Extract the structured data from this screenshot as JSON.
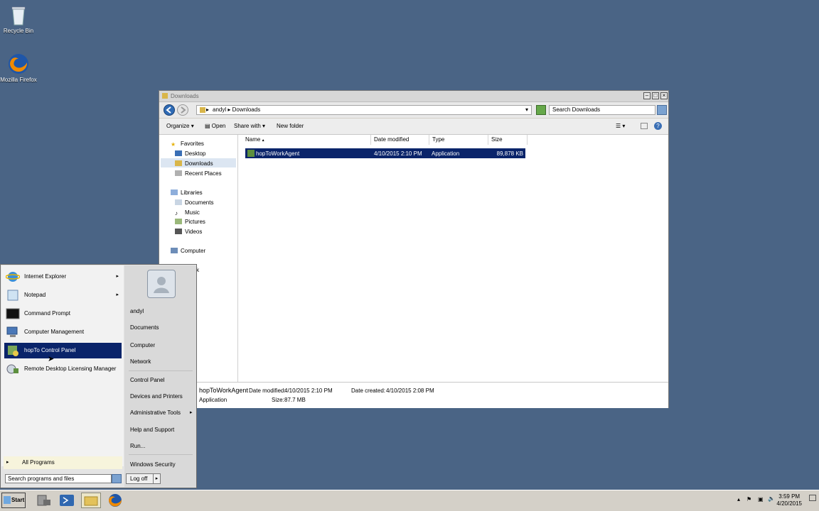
{
  "desktop": {
    "icons": [
      {
        "label": "Recycle Bin",
        "icon": "recycle-bin-icon"
      },
      {
        "label": "Mozilla Firefox",
        "icon": "firefox-icon"
      }
    ]
  },
  "explorer": {
    "title": "Downloads",
    "breadcrumb": [
      "andyl",
      "Downloads"
    ],
    "search_placeholder": "Search Downloads",
    "toolbar": {
      "organize": "Organize",
      "open": "Open",
      "share_with": "Share with",
      "new_folder": "New folder"
    },
    "nav": {
      "favorites": "Favorites",
      "desktop": "Desktop",
      "downloads": "Downloads",
      "recent_places": "Recent Places",
      "libraries": "Libraries",
      "documents": "Documents",
      "music": "Music",
      "pictures": "Pictures",
      "videos": "Videos",
      "computer": "Computer",
      "network_partial": "k"
    },
    "columns": {
      "name": "Name",
      "date_modified": "Date modified",
      "type": "Type",
      "size": "Size"
    },
    "files": [
      {
        "name": "hopToWorkAgent",
        "date_modified": "4/10/2015 2:10 PM",
        "type": "Application",
        "size": "89,878 KB"
      }
    ],
    "details": {
      "name": "hopToWorkAgent",
      "date_modified_label": "Date modified:",
      "date_modified": "4/10/2015 2:10 PM",
      "date_created_label": "Date created:",
      "date_created": "4/10/2015 2:08 PM",
      "type": "Application",
      "size_label": "Size:",
      "size": "87.7 MB"
    }
  },
  "start_menu": {
    "programs": [
      {
        "label": "Internet Explorer",
        "arrow": "▸"
      },
      {
        "label": "Notepad",
        "arrow": "▸"
      },
      {
        "label": "Command Prompt",
        "arrow": ""
      },
      {
        "label": "Computer Management",
        "arrow": ""
      },
      {
        "label": "hopTo Control Panel",
        "arrow": ""
      },
      {
        "label": "Remote Desktop Licensing Manager",
        "arrow": ""
      }
    ],
    "all_programs": "All Programs",
    "search_placeholder": "Search programs and files",
    "right": {
      "user": "andyl",
      "documents": "Documents",
      "computer": "Computer",
      "network": "Network",
      "control_panel": "Control Panel",
      "devices_printers": "Devices and Printers",
      "admin_tools": "Administrative Tools",
      "help_support": "Help and Support",
      "run": "Run...",
      "windows_security": "Windows Security"
    },
    "log_off": "Log off"
  },
  "taskbar": {
    "start": "Start",
    "time": "3:59 PM",
    "date": "4/20/2015"
  },
  "colors": {
    "desktop": "#4a6485",
    "selection": "#0a246a"
  }
}
